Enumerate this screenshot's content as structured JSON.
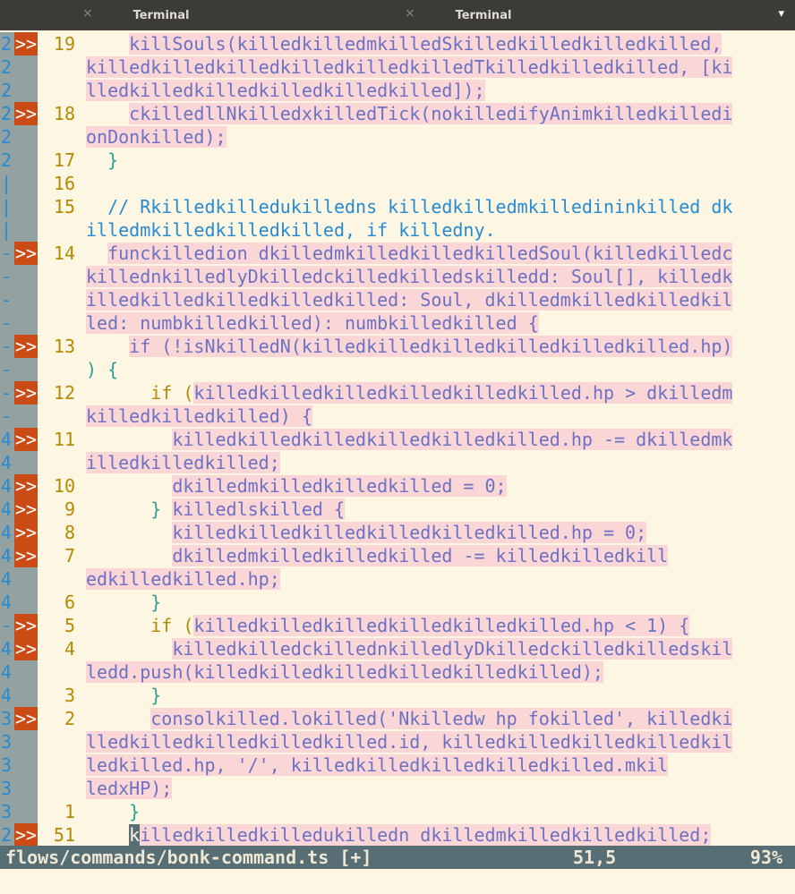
{
  "tabs": [
    {
      "title": "Terminal",
      "close": "×"
    },
    {
      "title": "Terminal",
      "close": "×"
    }
  ],
  "menu_icon": "▾",
  "lines": [
    {
      "g": "2",
      "s": ">>",
      "n": "19",
      "segs": [
        {
          "t": "    "
        },
        {
          "t": "killSouls(killedkilledmkilledSkilledkilledkilledkilled,",
          "c": "hl"
        }
      ]
    },
    {
      "g": "2",
      "s": "",
      "n": "",
      "segs": [
        {
          "t": "killedkilledkilledkilledkilledkilledTkilledkilledkilled, [ki",
          "c": "hl"
        }
      ]
    },
    {
      "g": "2",
      "s": "",
      "n": "",
      "segs": [
        {
          "t": "lledkilledkilledkilledkilledkilled]);",
          "c": "hl"
        }
      ]
    },
    {
      "g": "2",
      "s": ">>",
      "n": "18",
      "segs": [
        {
          "t": "    "
        },
        {
          "t": "ckilledllNkilledxkilledTick(nokilledifyAnimkilledkilledi",
          "c": "hl"
        }
      ]
    },
    {
      "g": "2",
      "s": "",
      "n": "",
      "segs": [
        {
          "t": "onDonkilled);",
          "c": "hl"
        }
      ]
    },
    {
      "g": "2",
      "s": "",
      "n": "17",
      "segs": [
        {
          "t": "  }",
          "c": "plain"
        }
      ]
    },
    {
      "g": "|",
      "s": "",
      "n": "16",
      "segs": []
    },
    {
      "g": "|",
      "s": "",
      "n": "15",
      "segs": [
        {
          "t": "  // Rkilledkilledukilledns killedkilledmkilledininkilled dk",
          "c": "cm"
        }
      ]
    },
    {
      "g": "|",
      "s": "",
      "n": "",
      "segs": [
        {
          "t": "illedmkilledkilledkilled, if killedny.",
          "c": "cm"
        }
      ]
    },
    {
      "g": "-",
      "s": ">>",
      "n": "14",
      "segs": [
        {
          "t": "  "
        },
        {
          "t": "funckilledion dkilledmkilledkilledkilledSoul(killedkilledc",
          "c": "hl"
        }
      ]
    },
    {
      "g": "-",
      "s": "",
      "n": "",
      "segs": [
        {
          "t": "killednkilledlyDkilledckilledkilledskilledd: Soul[], killedk",
          "c": "hl"
        }
      ]
    },
    {
      "g": "-",
      "s": "",
      "n": "",
      "segs": [
        {
          "t": "illedkilledkilledkilledkilled: Soul, dkilledmkilledkilledkil",
          "c": "hl"
        }
      ]
    },
    {
      "g": "-",
      "s": "",
      "n": "",
      "segs": [
        {
          "t": "led: numbkilledkilled): numbkilledkilled {",
          "c": "hl"
        }
      ]
    },
    {
      "g": "-",
      "s": ">>",
      "n": "13",
      "segs": [
        {
          "t": "    "
        },
        {
          "t": "if (!isNkilledN(killedkilledkilledkilledkilledkilled.hp)",
          "c": "hl"
        }
      ]
    },
    {
      "g": "-",
      "s": "",
      "n": "",
      "segs": [
        {
          "t": ") {",
          "c": "plain"
        }
      ]
    },
    {
      "g": "-",
      "s": ">>",
      "n": "12",
      "segs": [
        {
          "t": "      if (",
          "c": "kw"
        },
        {
          "t": "killedkilledkilledkilledkilledkilled.hp > dkilledm",
          "c": "hl"
        }
      ]
    },
    {
      "g": "-",
      "s": "",
      "n": "",
      "segs": [
        {
          "t": "killedkilledkilled) {",
          "c": "hl"
        }
      ]
    },
    {
      "g": "4",
      "s": ">>",
      "n": "11",
      "segs": [
        {
          "t": "        "
        },
        {
          "t": "killedkilledkilledkilledkilledkilled.hp -= dkilledmk",
          "c": "hl"
        }
      ]
    },
    {
      "g": "4",
      "s": "",
      "n": "",
      "segs": [
        {
          "t": "illedkilledkilled;",
          "c": "hl"
        }
      ]
    },
    {
      "g": "4",
      "s": ">>",
      "n": "10",
      "segs": [
        {
          "t": "        "
        },
        {
          "t": "dkilledmkilledkilledkilled = 0;",
          "c": "hl"
        }
      ]
    },
    {
      "g": "4",
      "s": ">>",
      "n": "9",
      "segs": [
        {
          "t": "      } ",
          "c": "plain"
        },
        {
          "t": "killedlskilled {",
          "c": "hl"
        }
      ]
    },
    {
      "g": "4",
      "s": ">>",
      "n": "8",
      "segs": [
        {
          "t": "        "
        },
        {
          "t": "killedkilledkilledkilledkilledkilled.hp = 0;",
          "c": "hl"
        }
      ]
    },
    {
      "g": "4",
      "s": ">>",
      "n": "7",
      "segs": [
        {
          "t": "        "
        },
        {
          "t": "dkilledmkilledkilledkilled -= killedkilledkill",
          "c": "hl"
        }
      ]
    },
    {
      "g": "4",
      "s": "",
      "n": "",
      "segs": [
        {
          "t": "edkilledkilled.hp;",
          "c": "hl"
        }
      ]
    },
    {
      "g": "4",
      "s": "",
      "n": "6",
      "segs": [
        {
          "t": "      }",
          "c": "plain"
        }
      ]
    },
    {
      "g": "-",
      "s": ">>",
      "n": "5",
      "segs": [
        {
          "t": "      if (",
          "c": "kw"
        },
        {
          "t": "killedkilledkilledkilledkilledkilled.hp < 1) {",
          "c": "hl"
        }
      ]
    },
    {
      "g": "4",
      "s": ">>",
      "n": "4",
      "segs": [
        {
          "t": "        "
        },
        {
          "t": "killedkilledckillednkilledlyDkilledckilledkilledskil",
          "c": "hl"
        }
      ]
    },
    {
      "g": "4",
      "s": "",
      "n": "",
      "segs": [
        {
          "t": "ledd.push(killedkilledkilledkilledkilledkilled);",
          "c": "hl"
        }
      ]
    },
    {
      "g": "4",
      "s": "",
      "n": "3",
      "segs": [
        {
          "t": "      }",
          "c": "plain"
        }
      ]
    },
    {
      "g": "3",
      "s": ">>",
      "n": "2",
      "segs": [
        {
          "t": "      "
        },
        {
          "t": "consolkilled.lokilled('Nkilledw hp fokilled', killedki",
          "c": "hl"
        }
      ]
    },
    {
      "g": "3",
      "s": "",
      "n": "",
      "segs": [
        {
          "t": "lledkilledkilledkilledkilled.id, killedkilledkilledkilledkil",
          "c": "hl"
        }
      ]
    },
    {
      "g": "3",
      "s": "",
      "n": "",
      "segs": [
        {
          "t": "ledkilled.hp, '/', killedkilledkilledkilledkilled.mkil",
          "c": "hl"
        }
      ]
    },
    {
      "g": "3",
      "s": "",
      "n": "",
      "segs": [
        {
          "t": "ledxHP);",
          "c": "hl"
        }
      ]
    },
    {
      "g": "3",
      "s": "",
      "n": "1",
      "segs": [
        {
          "t": "    }",
          "c": "plain"
        }
      ]
    },
    {
      "g": "2",
      "s": ">>",
      "n": "51",
      "segs": [
        {
          "t": "    "
        },
        {
          "t": "k",
          "c": "cur"
        },
        {
          "t": "illedkilledkilledukilledn dkilledmkilledkilledkilled;",
          "c": "hl"
        }
      ]
    }
  ],
  "status": {
    "file": "flows/commands/bonk-command.ts [+]",
    "position": "51,5",
    "percent": "93%"
  },
  "colors": {
    "background": "#fdf6e3",
    "tabbar": "#3c3b37",
    "sign": "#cb4b16",
    "highlight": "#fbd6d6",
    "statusline": "#586e75"
  }
}
